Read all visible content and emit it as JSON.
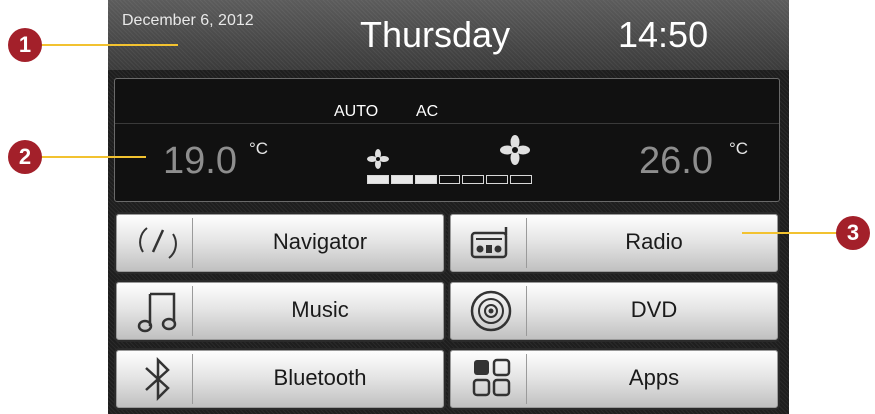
{
  "header": {
    "date": "December 6, 2012",
    "day": "Thursday",
    "time": "14:50"
  },
  "climate": {
    "mode_auto": "AUTO",
    "mode_ac": "AC",
    "left_temp": "19.0",
    "right_temp": "26.0",
    "unit": "°C",
    "fan_level": 3,
    "fan_segments": 7
  },
  "buttons": [
    {
      "label": "Navigator",
      "icon": "compass-icon"
    },
    {
      "label": "Radio",
      "icon": "radio-icon"
    },
    {
      "label": "Music",
      "icon": "music-note-icon"
    },
    {
      "label": "DVD",
      "icon": "disc-icon"
    },
    {
      "label": "Bluetooth",
      "icon": "bluetooth-icon"
    },
    {
      "label": "Apps",
      "icon": "apps-grid-icon"
    }
  ],
  "callouts": [
    "1",
    "2",
    "3"
  ],
  "colors": {
    "callout": "#a3202a",
    "callout_line": "#f2c230"
  }
}
